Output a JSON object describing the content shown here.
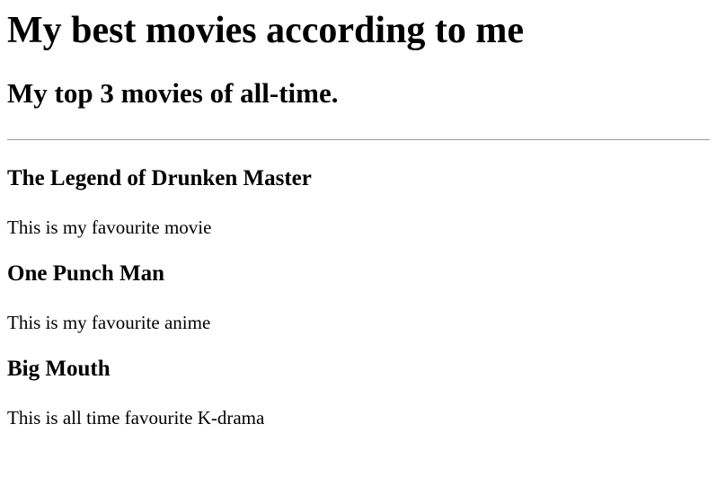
{
  "page": {
    "title": "My best movies according to me",
    "subtitle": "My top 3 movies of all-time."
  },
  "movies": [
    {
      "title": "The Legend of Drunken Master",
      "description": "This is my favourite movie"
    },
    {
      "title": "One Punch Man",
      "description": "This is my favourite anime"
    },
    {
      "title": "Big Mouth",
      "description": "This is all time favourite K-drama"
    }
  ]
}
